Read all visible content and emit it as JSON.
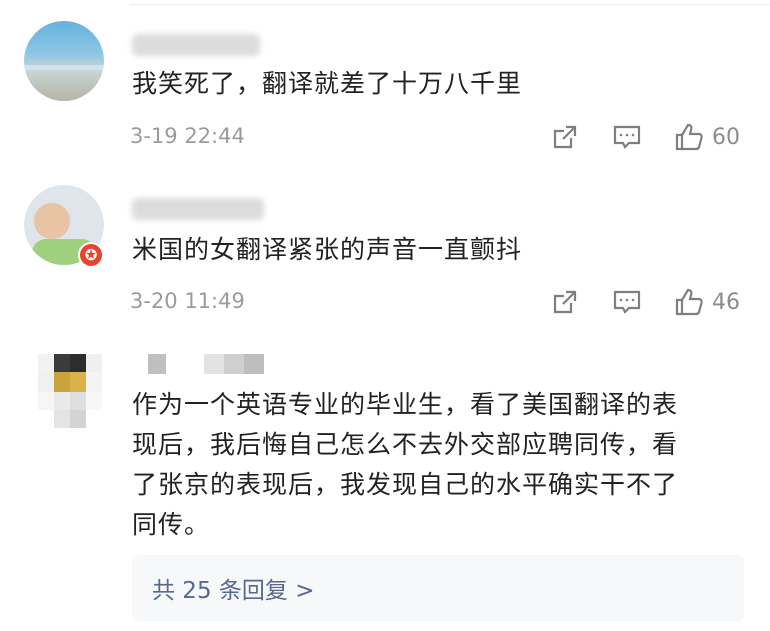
{
  "comments": [
    {
      "text": "我笑死了，翻译就差了十万八千里",
      "time": "3-19 22:44",
      "likes": "60"
    },
    {
      "text": "米国的女翻译紧张的声音一直颤抖",
      "time": "3-20 11:49",
      "likes": "46"
    },
    {
      "text_lines": [
        "作为一个英语专业的毕业生，看了美国翻译的表",
        "现后，我后悔自己怎么不去外交部应聘同传，看",
        "了张京的表现后，我发现自己的水平确实干不了",
        "同传。"
      ],
      "replies_label": "共 25 条回复 >"
    }
  ],
  "icons": [
    "share-icon",
    "comment-icon",
    "like-icon",
    "verified-badge-icon"
  ],
  "colors": {
    "meta_gray": "#9b9b9b",
    "reply_link": "#57698e",
    "badge_red": "#e8432f"
  }
}
